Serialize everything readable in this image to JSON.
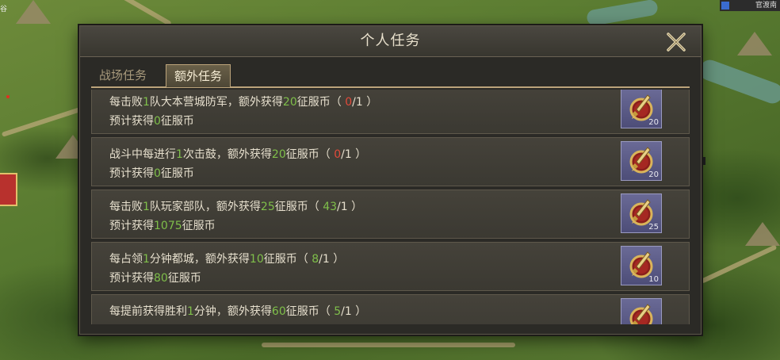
{
  "map": {
    "left_label": "谷",
    "top_right_label": "官渡南"
  },
  "dialog": {
    "title": "个人任务"
  },
  "tabs": [
    {
      "label": "战场任务",
      "active": false
    },
    {
      "label": "额外任务",
      "active": true
    }
  ],
  "tasks": [
    {
      "line1": [
        {
          "t": "每击败",
          "c": "n"
        },
        {
          "t": "1",
          "c": "g"
        },
        {
          "t": "队大本营城防军，额外获得",
          "c": "n"
        },
        {
          "t": "20",
          "c": "g"
        },
        {
          "t": "征服币（ ",
          "c": "n"
        },
        {
          "t": "0",
          "c": "r"
        },
        {
          "t": "/1 ）",
          "c": "n"
        }
      ],
      "line2": [
        {
          "t": "预计获得",
          "c": "n"
        },
        {
          "t": "0",
          "c": "g"
        },
        {
          "t": "征服币",
          "c": "n"
        }
      ],
      "reward_count": "20"
    },
    {
      "line1": [
        {
          "t": "战斗中每进行",
          "c": "n"
        },
        {
          "t": "1",
          "c": "g"
        },
        {
          "t": "次击鼓，额外获得",
          "c": "n"
        },
        {
          "t": "20",
          "c": "g"
        },
        {
          "t": "征服币（ ",
          "c": "n"
        },
        {
          "t": "0",
          "c": "r"
        },
        {
          "t": "/1 ）",
          "c": "n"
        }
      ],
      "line2": [
        {
          "t": "预计获得",
          "c": "n"
        },
        {
          "t": "0",
          "c": "g"
        },
        {
          "t": "征服币",
          "c": "n"
        }
      ],
      "reward_count": "20"
    },
    {
      "line1": [
        {
          "t": "每击败",
          "c": "n"
        },
        {
          "t": "1",
          "c": "g"
        },
        {
          "t": "队玩家部队，额外获得",
          "c": "n"
        },
        {
          "t": "25",
          "c": "g"
        },
        {
          "t": "征服币（ ",
          "c": "n"
        },
        {
          "t": "43",
          "c": "g"
        },
        {
          "t": "/1 ）",
          "c": "n"
        }
      ],
      "line2": [
        {
          "t": "预计获得",
          "c": "n"
        },
        {
          "t": "1075",
          "c": "g"
        },
        {
          "t": "征服币",
          "c": "n"
        }
      ],
      "reward_count": "25"
    },
    {
      "line1": [
        {
          "t": "每占领",
          "c": "n"
        },
        {
          "t": "1",
          "c": "g"
        },
        {
          "t": "分钟都城，额外获得",
          "c": "n"
        },
        {
          "t": "10",
          "c": "g"
        },
        {
          "t": "征服币（ ",
          "c": "n"
        },
        {
          "t": "8",
          "c": "g"
        },
        {
          "t": "/1 ）",
          "c": "n"
        }
      ],
      "line2": [
        {
          "t": "预计获得",
          "c": "n"
        },
        {
          "t": "80",
          "c": "g"
        },
        {
          "t": "征服币",
          "c": "n"
        }
      ],
      "reward_count": "10"
    },
    {
      "line1": [
        {
          "t": "每提前获得胜利",
          "c": "n"
        },
        {
          "t": "1",
          "c": "g"
        },
        {
          "t": "分钟，额外获得",
          "c": "n"
        },
        {
          "t": "60",
          "c": "g"
        },
        {
          "t": "征服币（ ",
          "c": "n"
        },
        {
          "t": "5",
          "c": "g"
        },
        {
          "t": "/1 ）",
          "c": "n"
        }
      ],
      "line2": [],
      "reward_count": ""
    }
  ],
  "colors": {
    "green_value": "#7fbf4a",
    "red_value": "#e04a3a",
    "text": "#e6dfcd"
  },
  "icons": {
    "close": "close-x-icon",
    "reward": "sword-medal-icon"
  }
}
